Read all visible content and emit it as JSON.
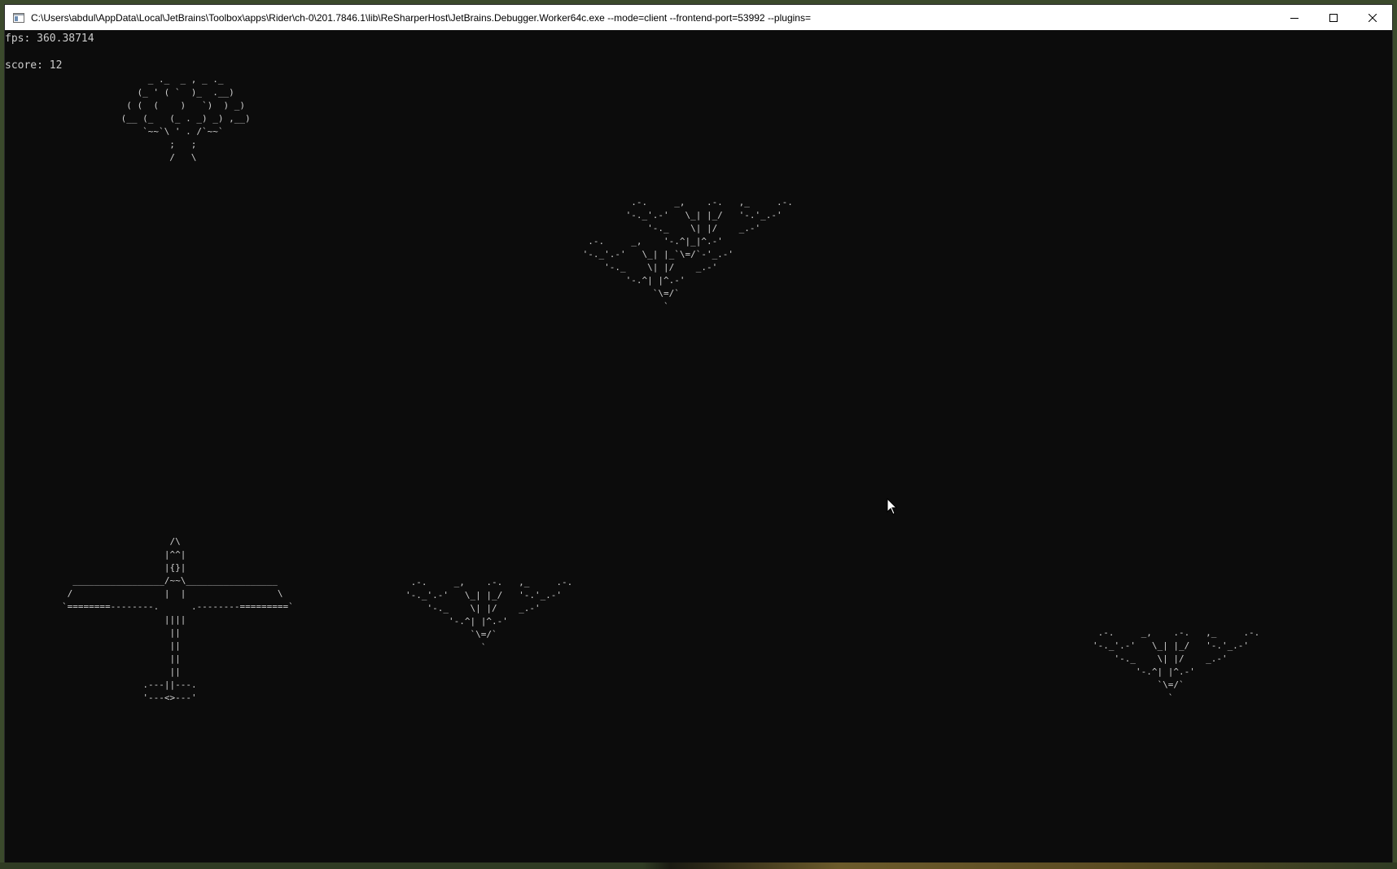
{
  "window": {
    "title": "C:\\Users\\abdul\\AppData\\Local\\JetBrains\\Toolbox\\apps\\Rider\\ch-0\\201.7846.1\\lib\\ReSharperHost\\JetBrains.Debugger.Worker64c.exe --mode=client --frontend-port=53992 --plugins=",
    "icon": "console-app-icon",
    "controls": {
      "minimize": "minimize-icon",
      "maximize": "maximize-icon",
      "close": "close-icon"
    }
  },
  "hud": {
    "fps": "fps: 360.38714",
    "score": "score: 12"
  },
  "sprites": {
    "explosion": "      _ ._  _ , _ ._\n    (_ ' ( `  )_  .__)\n  ( (  (    )   `)  ) _)\n (__ (_   (_ . _) _) ,__)\n     `~~`\\ ' . /`~~`\n          ;   ;\n          /   \\",
    "bomber_large": "          .-.     _,    .-.   ,_     .-.\n         '-._'.-'   \\_| |_/   '-.'_.-'\n             '-._    \\| |/    _.-'\n  .-.     _,    '-.^|_|^.-'\n '-._'.-'   \\_| |_`\\=/`-'_.-'\n     '-._    \\| |/    _.-'\n         '-.^| |^.-'\n              `\\=/`\n                `",
    "player_plane": "                    /\\\n                   |^^|\n                   |{}|\n  _________________/~~\\_________________\n /                 |  |                 \\\n`========--------.      .--------=========`\n                   ||||\n                    ||\n                    ||\n                    ||\n                    ||\n               .---||---.\n               '---<>---'",
    "bomber_small": " .-.     _,    .-.   ,_     .-.\n'-._'.-'   \\_| |_/   '-.'_.-'\n    '-._    \\| |/    _.-'\n        '-.^| |^.-'\n            `\\=/`\n              `"
  }
}
